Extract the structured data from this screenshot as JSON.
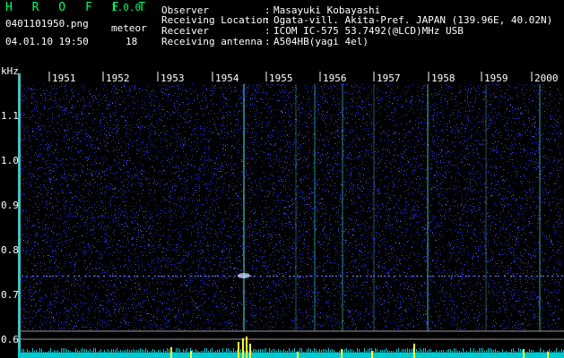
{
  "app": {
    "title": "H R O F F T",
    "version": "1.0.0"
  },
  "file": {
    "name": "0401101950.png",
    "datetime": "04.01.10 19:50"
  },
  "meteor": {
    "label": "meteor",
    "count": "18"
  },
  "info": [
    {
      "key": "Observer",
      "sep": ":",
      "value": "Masayuki Kobayashi"
    },
    {
      "key": "Receiving Location",
      "sep": ":",
      "value": "Ogata-vill. Akita-Pref. JAPAN (139.96E, 40.02N)"
    },
    {
      "key": "Receiver",
      "sep": ":",
      "value": "ICOM IC-575 53.7492(@LCD)MHz USB"
    },
    {
      "key": "Receiving antenna",
      "sep": ":",
      "value": "A504HB(yagi 4el)"
    }
  ],
  "axis": {
    "unit": "kHz",
    "freq_ticks": [
      "1.1",
      "1.0",
      "0.9",
      "0.8",
      "0.7",
      "0.6"
    ],
    "time_ticks": [
      "1951",
      "1952",
      "1953",
      "1954",
      "1955",
      "1956",
      "1957",
      "1958",
      "1959",
      "2000"
    ]
  },
  "colors": {
    "background": "#000000",
    "noise": "#2a3cff",
    "meteor_trace": "#60ffff",
    "level_bars": "#ffff33",
    "level_floor": "#00c8d0",
    "title_green": "#00ff66"
  }
}
